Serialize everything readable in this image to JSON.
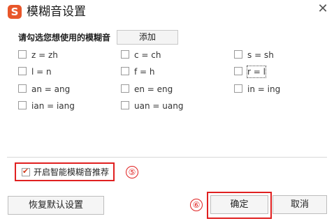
{
  "window": {
    "title": "模糊音设置",
    "logo_letter": "S"
  },
  "section": {
    "label": "请勾选您想使用的模糊音",
    "add_button": "添加"
  },
  "options": [
    {
      "label": "z = zh",
      "checked": false
    },
    {
      "label": "c = ch",
      "checked": false
    },
    {
      "label": "s = sh",
      "checked": false
    },
    {
      "label": "l = n",
      "checked": false
    },
    {
      "label": "f = h",
      "checked": false
    },
    {
      "label": "r = l",
      "checked": false,
      "focused": true
    },
    {
      "label": "an = ang",
      "checked": false
    },
    {
      "label": "en = eng",
      "checked": false
    },
    {
      "label": "in = ing",
      "checked": false
    },
    {
      "label": "ian = iang",
      "checked": false
    },
    {
      "label": "uan = uang",
      "checked": false
    }
  ],
  "smart": {
    "label": "开启智能模糊音推荐",
    "checked": true
  },
  "annotations": {
    "five": "⑤",
    "six": "⑥"
  },
  "buttons": {
    "restore": "恢复默认设置",
    "ok": "确定",
    "cancel": "取消"
  },
  "colors": {
    "logo": "#e8562a",
    "highlight": "#e02020"
  }
}
